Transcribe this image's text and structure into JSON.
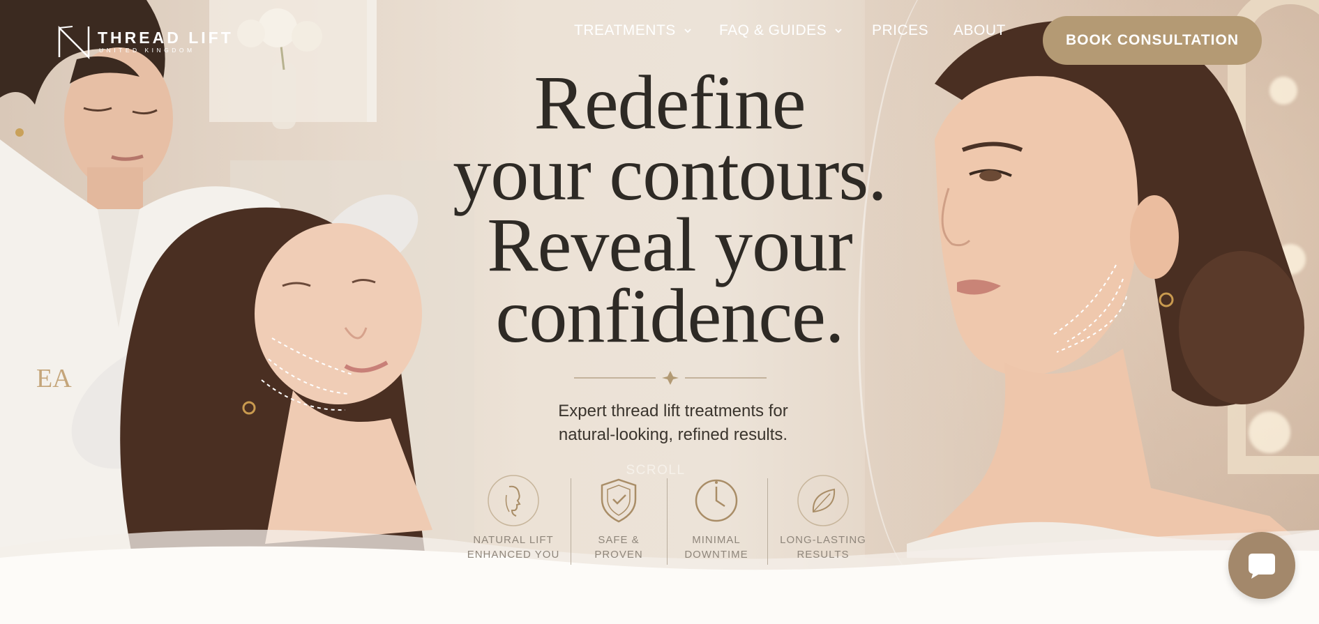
{
  "brand": {
    "logo_icon": "n-monogram-icon",
    "name": "THREAD LIFT",
    "sub": "UNITED KINGDOM"
  },
  "nav": {
    "items": [
      {
        "label": "TREATMENTS",
        "has_dropdown": true
      },
      {
        "label": "FAQ & GUIDES",
        "has_dropdown": true
      },
      {
        "label": "PRICES",
        "has_dropdown": false
      },
      {
        "label": "ABOUT",
        "has_dropdown": false
      }
    ],
    "cta_label": "BOOK CONSULTATION"
  },
  "hero": {
    "headline_lines": [
      "Redefine",
      "your contours.",
      "Reveal your",
      "confidence."
    ],
    "subtext_lines": [
      "Expert thread lift treatments for",
      "natural-looking, refined results."
    ],
    "scroll_label": "SCROLL"
  },
  "features": [
    {
      "icon": "face-profile-icon",
      "line1": "NATURAL LIFT",
      "line2": "ENHANCED YOU"
    },
    {
      "icon": "shield-icon",
      "line1": "SAFE &",
      "line2": "PROVEN"
    },
    {
      "icon": "clock-icon",
      "line1": "MINIMAL",
      "line2": "DOWNTIME"
    },
    {
      "icon": "leaf-icon",
      "line1": "LONG-LASTING",
      "line2": "RESULTS"
    }
  ],
  "chat": {
    "icon": "chat-bubble-icon"
  },
  "colors": {
    "accent": "#b49a74",
    "chat": "#a3886b",
    "headline": "#2e2a25",
    "background": "#fdfbf8"
  }
}
